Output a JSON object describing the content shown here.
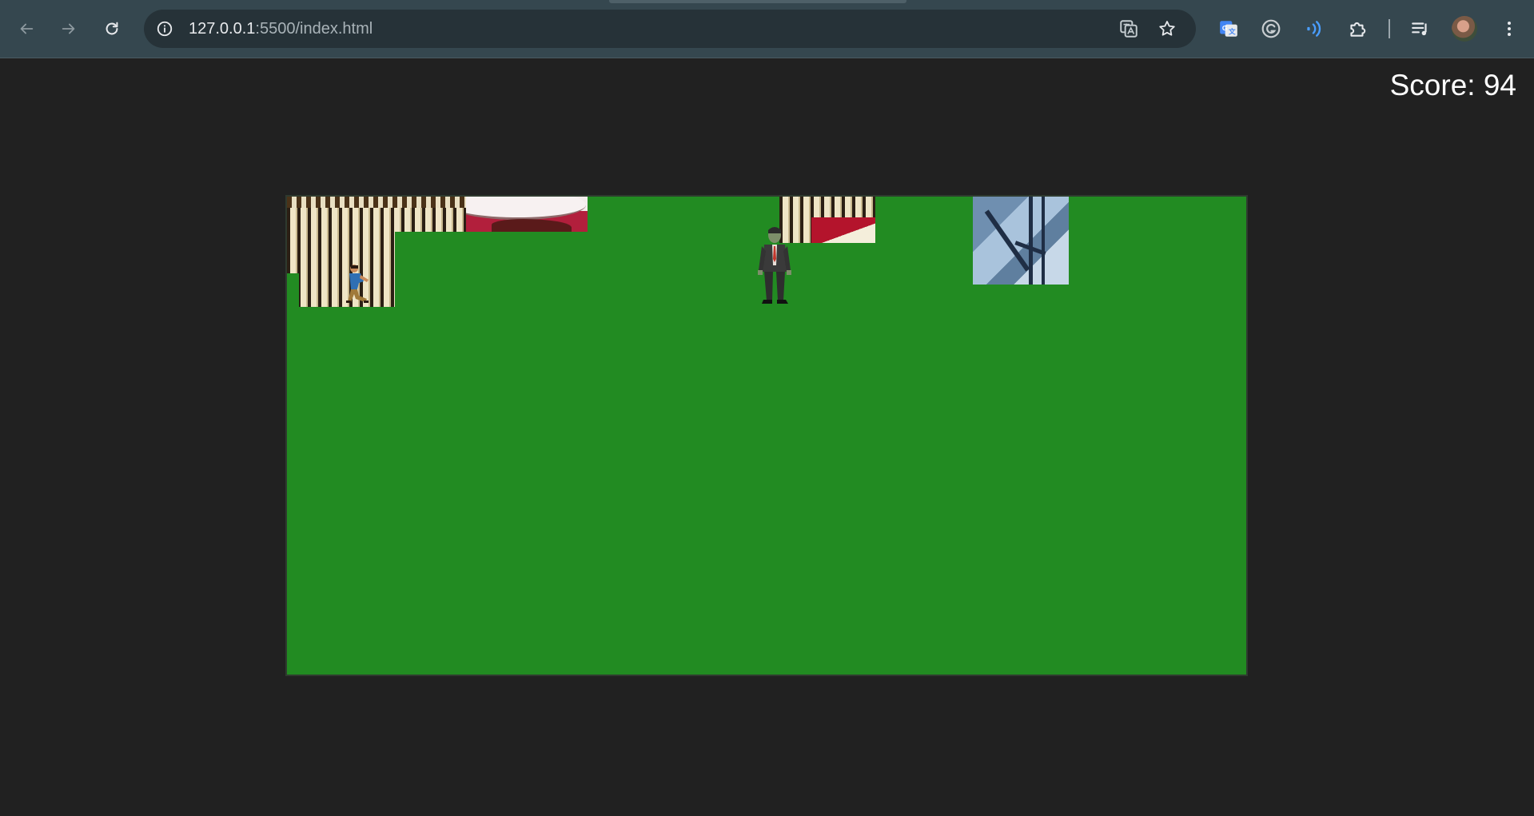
{
  "browser": {
    "url_host": "127.0.0.1",
    "url_path": ":5500/index.html"
  },
  "game": {
    "score_text": "Score: 94",
    "colors": {
      "background": "#212121",
      "board": "#228b22",
      "score_text": "#ffffff"
    },
    "icons": {
      "back": "arrow-left-icon",
      "forward": "arrow-right-icon",
      "reload": "reload-icon",
      "info": "info-icon",
      "translate": "translate-icon",
      "bookmark": "star-icon",
      "google_translate_ext": "google-translate-icon",
      "grammarly_ext": "grammarly-icon",
      "read_aloud_ext": "sound-waves-icon",
      "extensions": "puzzle-icon",
      "media": "media-queue-icon",
      "menu": "kebab-menu-icon"
    }
  }
}
